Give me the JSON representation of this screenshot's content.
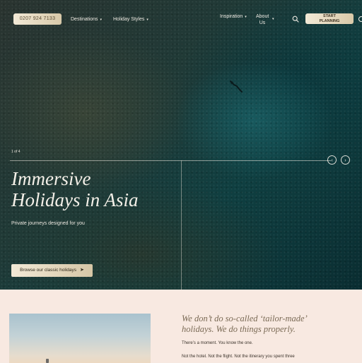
{
  "header": {
    "phone": "0207 924 7133",
    "nav": [
      {
        "label": "Destinations"
      },
      {
        "label": "Holiday Styles"
      },
      {
        "label": "Inspiration"
      },
      {
        "label": "About Us"
      }
    ],
    "about_line1": "About",
    "about_line2": "Us",
    "search_icon": "search-icon",
    "cta_line1": "START",
    "cta_line2": "PLANNING"
  },
  "hero": {
    "counter": "1 of 4",
    "title_line1": "Immersive",
    "title_line2": "Holidays in Asia",
    "subtitle": "Private journeys designed for you",
    "button_label": "Browse our classic holidays",
    "button_icon": "arrow-right-icon",
    "prev_icon": "chevron-left-icon",
    "next_icon": "chevron-right-icon"
  },
  "intro": {
    "tagline_line1": "We don’t do so-called ‘tailor-made’",
    "tagline_line2": "holidays. We do things properly.",
    "para1": "There’s a moment. You know the one.",
    "para2": "Not the hotel. Not the flight. Not the itinerary you spent three"
  },
  "colors": {
    "gold_start": "#f2e9d6",
    "gold_end": "#d8c9a9",
    "section_bg": "#f8e9e1",
    "tagline": "#7a6a55"
  }
}
